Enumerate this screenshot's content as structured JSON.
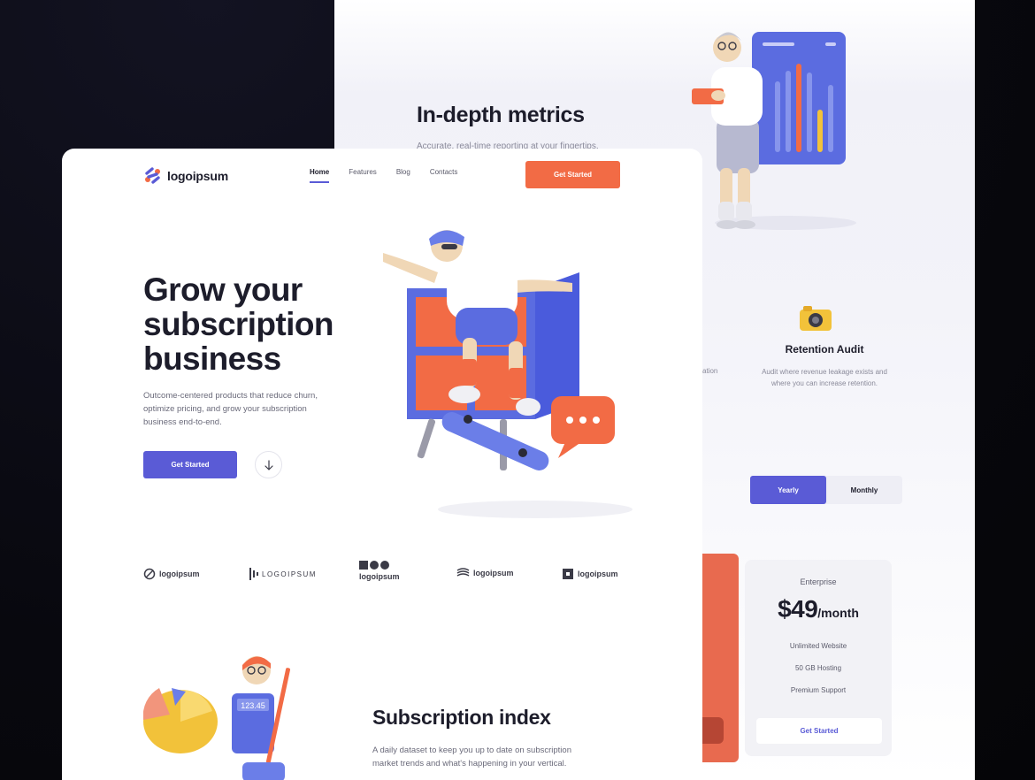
{
  "back_page": {
    "metrics_title": "In-depth metrics",
    "metrics_desc": "Accurate, real-time reporting at your fingertips.",
    "partial_text": "zation",
    "retention_title": "Retention Audit",
    "retention_desc": "Audit where revenue leakage exists and where you can increase retention.",
    "toggle": {
      "yearly": "Yearly",
      "monthly": "Monthly"
    },
    "pricing": {
      "plan": "Enterprise",
      "amount": "$49",
      "period": "/month",
      "features": [
        "Unlimited Website",
        "50 GB Hosting",
        "Premium Support"
      ],
      "cta": "Get Started"
    }
  },
  "header": {
    "logo_text": "logoipsum",
    "nav": [
      "Home",
      "Features",
      "Blog",
      "Contacts"
    ],
    "cta": "Get Started"
  },
  "hero": {
    "title": "Grow your subscription business",
    "desc": "Outcome-centered products that reduce churn, optimize pricing, and grow your subscription business end-to-end.",
    "cta": "Get Started"
  },
  "partners": [
    "logoipsum",
    "LOGOIPSUM",
    "logoipsum",
    "logoipsum",
    "logoipsum"
  ],
  "subscription": {
    "title": "Subscription index",
    "desc": "A daily dataset to keep you up to date on subscription market trends and what's happening in your vertical.",
    "calculator_display": "123.45"
  },
  "colors": {
    "accent": "#5a5bd6",
    "orange": "#f26b45",
    "text": "#1d1d2b"
  }
}
